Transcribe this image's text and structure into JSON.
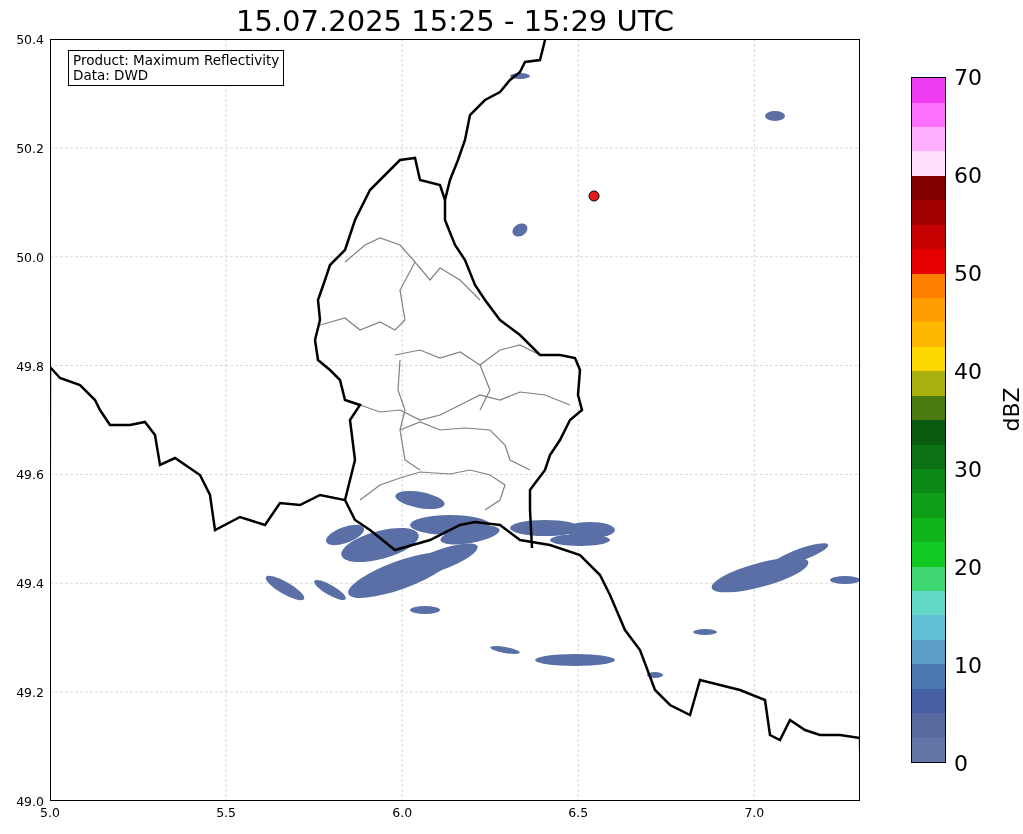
{
  "title": "15.07.2025 15:25 - 15:29 UTC",
  "info_box": {
    "lines": [
      "Product: Maximum Reflectivity",
      "Data: DWD"
    ]
  },
  "x_ticks": [
    "5.0",
    "5.5",
    "6.0",
    "6.5",
    "7.0"
  ],
  "y_ticks": [
    "50.4",
    "50.2",
    "50.0",
    "49.8",
    "49.6",
    "49.4",
    "49.2",
    "49.0"
  ],
  "colorbar": {
    "label": "dBZ",
    "ticks": [
      "70",
      "60",
      "50",
      "40",
      "30",
      "20",
      "10",
      "0"
    ],
    "segments": [
      {
        "color": "#6475a8"
      },
      {
        "color": "#58699f"
      },
      {
        "color": "#4560a3"
      },
      {
        "color": "#4a78b0"
      },
      {
        "color": "#5a9ec8"
      },
      {
        "color": "#62bfd8"
      },
      {
        "color": "#62d8c8"
      },
      {
        "color": "#3ed672"
      },
      {
        "color": "#12c822"
      },
      {
        "color": "#12b41c"
      },
      {
        "color": "#0f9e18"
      },
      {
        "color": "#0c8816"
      },
      {
        "color": "#0c7014"
      },
      {
        "color": "#0a5a10"
      },
      {
        "color": "#4a7a10"
      },
      {
        "color": "#aab010"
      },
      {
        "color": "#fed600"
      },
      {
        "color": "#feb800"
      },
      {
        "color": "#fe9e00"
      },
      {
        "color": "#fe8000"
      },
      {
        "color": "#e40000"
      },
      {
        "color": "#c40000"
      },
      {
        "color": "#a00000"
      },
      {
        "color": "#800000"
      },
      {
        "color": "#fee0fe"
      },
      {
        "color": "#feb0fe"
      },
      {
        "color": "#fe70fe"
      },
      {
        "color": "#f03cf0"
      }
    ]
  }
}
